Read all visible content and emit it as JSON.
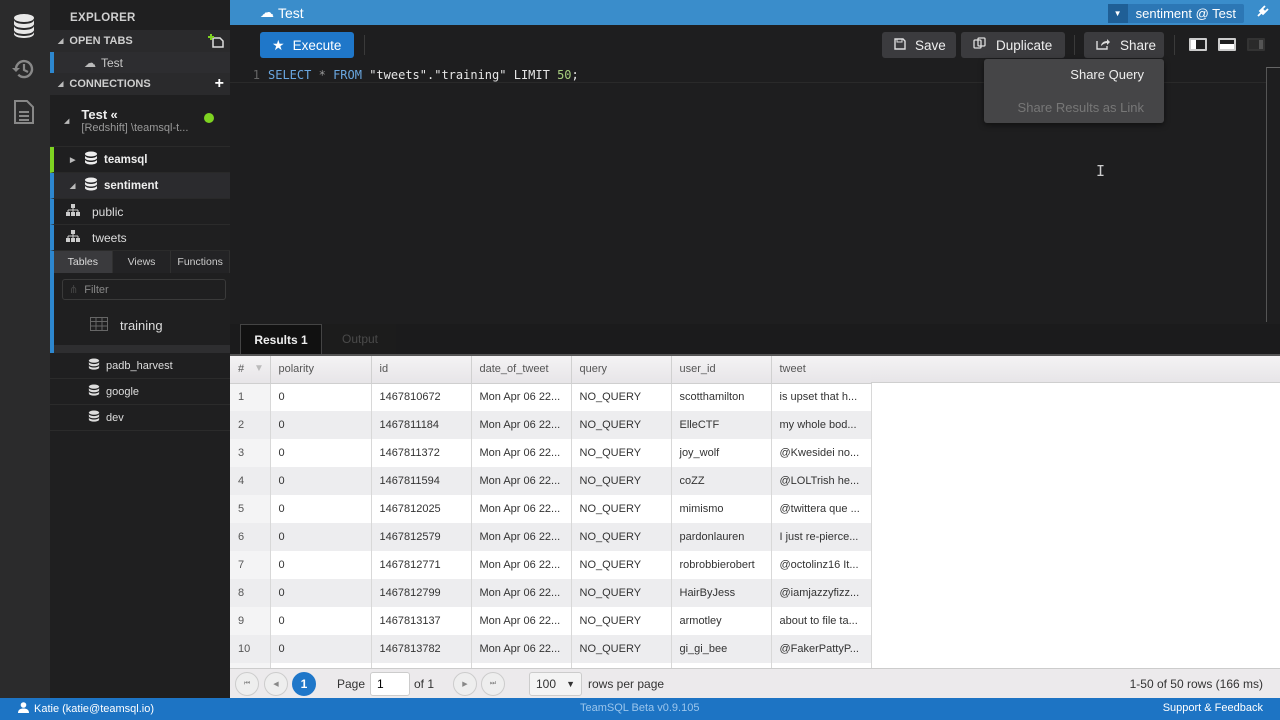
{
  "sidebar": {
    "title": "EXPLORER",
    "open_tabs_label": "OPEN TABS",
    "open_tabs": [
      {
        "label": "Test",
        "icon": "cloud-icon"
      }
    ],
    "connections_label": "CONNECTIONS",
    "connection": {
      "name": "Test",
      "collapse_glyph": "«",
      "subtitle": "[Redshift] \\teamsql-t...",
      "status_color": "#7ed321"
    },
    "databases": [
      {
        "name": "teamsql",
        "expanded": false,
        "accent": "#7ed321"
      },
      {
        "name": "sentiment",
        "expanded": true,
        "accent": "#2d87cf"
      }
    ],
    "schemas": [
      {
        "name": "public"
      },
      {
        "name": "tweets"
      }
    ],
    "object_tabs": [
      "Tables",
      "Views",
      "Functions"
    ],
    "filter_placeholder": "Filter",
    "tables": [
      {
        "name": "training"
      }
    ],
    "other_databases": [
      {
        "name": "padb_harvest"
      },
      {
        "name": "google"
      },
      {
        "name": "dev"
      }
    ]
  },
  "topbar": {
    "tab_title": "Test",
    "connection_selector": "sentiment @ Test"
  },
  "toolbar": {
    "execute_label": "Execute",
    "save_label": "Save",
    "duplicate_label": "Duplicate",
    "share_label": "Share"
  },
  "share_menu": {
    "items": [
      {
        "label": "Share Query",
        "enabled": true
      },
      {
        "label": "Share Results as Link",
        "enabled": false
      }
    ]
  },
  "editor": {
    "line_number": "1",
    "tokens": {
      "select": "SELECT",
      "star": "*",
      "from": "FROM",
      "table": "\"tweets\".\"training\"",
      "limit": "LIMIT",
      "limit_value": "50",
      "end": ";"
    }
  },
  "results": {
    "tabs": [
      {
        "label": "Results 1",
        "active": true
      },
      {
        "label": "Output",
        "active": false
      }
    ],
    "columns": [
      "#",
      "polarity",
      "id",
      "date_of_tweet",
      "query",
      "user_id",
      "tweet"
    ],
    "rows": [
      [
        "1",
        "0",
        "1467810672",
        "Mon Apr 06 22...",
        "NO_QUERY",
        "scotthamilton",
        "is upset that h..."
      ],
      [
        "2",
        "0",
        "1467811184",
        "Mon Apr 06 22...",
        "NO_QUERY",
        "ElleCTF",
        "my whole bod..."
      ],
      [
        "3",
        "0",
        "1467811372",
        "Mon Apr 06 22...",
        "NO_QUERY",
        "joy_wolf",
        "@Kwesidei no..."
      ],
      [
        "4",
        "0",
        "1467811594",
        "Mon Apr 06 22...",
        "NO_QUERY",
        "coZZ",
        "@LOLTrish he..."
      ],
      [
        "5",
        "0",
        "1467812025",
        "Mon Apr 06 22...",
        "NO_QUERY",
        "mimismo",
        "@twittera que ..."
      ],
      [
        "6",
        "0",
        "1467812579",
        "Mon Apr 06 22...",
        "NO_QUERY",
        "pardonlauren",
        "I just re-pierce..."
      ],
      [
        "7",
        "0",
        "1467812771",
        "Mon Apr 06 22...",
        "NO_QUERY",
        "robrobbierobert",
        "@octolinz16 It..."
      ],
      [
        "8",
        "0",
        "1467812799",
        "Mon Apr 06 22...",
        "NO_QUERY",
        "HairByJess",
        "@iamjazzyfizz..."
      ],
      [
        "9",
        "0",
        "1467813137",
        "Mon Apr 06 22...",
        "NO_QUERY",
        "armotley",
        "about to file ta..."
      ],
      [
        "10",
        "0",
        "1467813782",
        "Mon Apr 06 22...",
        "NO_QUERY",
        "gi_gi_bee",
        "@FakerPattyP..."
      ]
    ]
  },
  "pager": {
    "current_page": "1",
    "page_label": "Page",
    "page_input": "1",
    "of_label": "of 1",
    "rows_per_page": "100",
    "rows_per_page_label": "rows per page",
    "summary": "1-50 of 50 rows (166 ms)"
  },
  "status": {
    "user": "Katie (katie@teamsql.io)",
    "version": "TeamSQL Beta v0.9.105",
    "support": "Support & Feedback"
  },
  "colors": {
    "accent": "#1f77c9",
    "topbar": "#3a8dcb",
    "status_bar": "#1d74c4",
    "connected": "#7ed321"
  }
}
